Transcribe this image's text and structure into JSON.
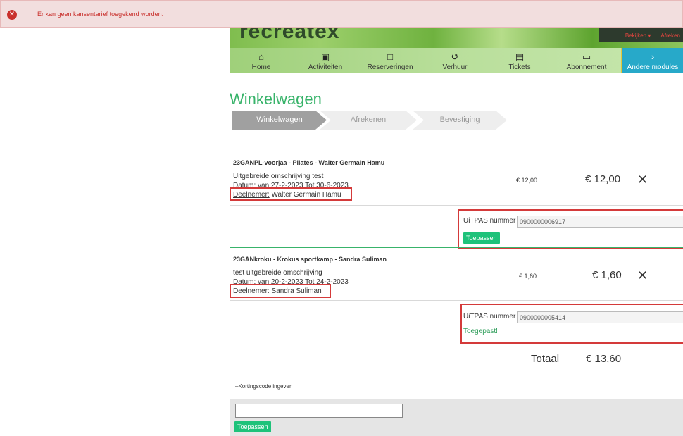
{
  "error": {
    "message": "Er kan geen kansentarief toegekend worden."
  },
  "header": {
    "logo": "recreatex",
    "links": {
      "view": "Bekijken ▾",
      "separator": "|",
      "checkout": "Afreken"
    }
  },
  "nav": [
    {
      "label": "Home",
      "icon": "home-icon"
    },
    {
      "label": "Activiteiten",
      "icon": "calendar-icon"
    },
    {
      "label": "Reserveringen",
      "icon": "clipboard-icon"
    },
    {
      "label": "Verhuur",
      "icon": "history-icon"
    },
    {
      "label": "Tickets",
      "icon": "ticket-icon"
    },
    {
      "label": "Abonnement",
      "icon": "monitor-icon"
    },
    {
      "label": "Andere modules",
      "icon": "chevron-right-icon"
    }
  ],
  "page_title": "Winkelwagen",
  "steps": [
    "Winkelwagen",
    "Afrekenen",
    "Bevestiging"
  ],
  "items": [
    {
      "name": "23GANPL-voorjaa - Pilates - Walter Germain Hamu",
      "description": "Uitgebreide omschrijving test",
      "date_label": "Datum:",
      "date_value": " van 27-2-2023 Tot 30-6-2023",
      "participant_label": "Deelnemer:",
      "participant_value": " Walter Germain Hamu",
      "unit_price": "€ 12,00",
      "price": "€ 12,00",
      "uitpas_label": "UiTPAS nummer",
      "uitpas_value": "0900000006917",
      "uitpas_action": "Toepassen"
    },
    {
      "name": "23GANkroku - Krokus sportkamp - Sandra Suliman",
      "description": "test uitgebreide omschrijving",
      "date_label": "Datum:",
      "date_value": " van 20-2-2023 Tot 24-2-2023",
      "participant_label": "Deelnemer:",
      "participant_value": " Sandra Suliman",
      "unit_price": "€ 1,60",
      "price": "€ 1,60",
      "uitpas_label": "UiTPAS nummer",
      "uitpas_value": "0900000005414",
      "uitpas_status": "Toegepast!"
    }
  ],
  "remove_symbol": "✕",
  "total": {
    "label": "Totaal",
    "value": "€ 13,60"
  },
  "discount": {
    "toggle": "Kortingscode ingeven",
    "value": "",
    "button": "Toepassen"
  }
}
